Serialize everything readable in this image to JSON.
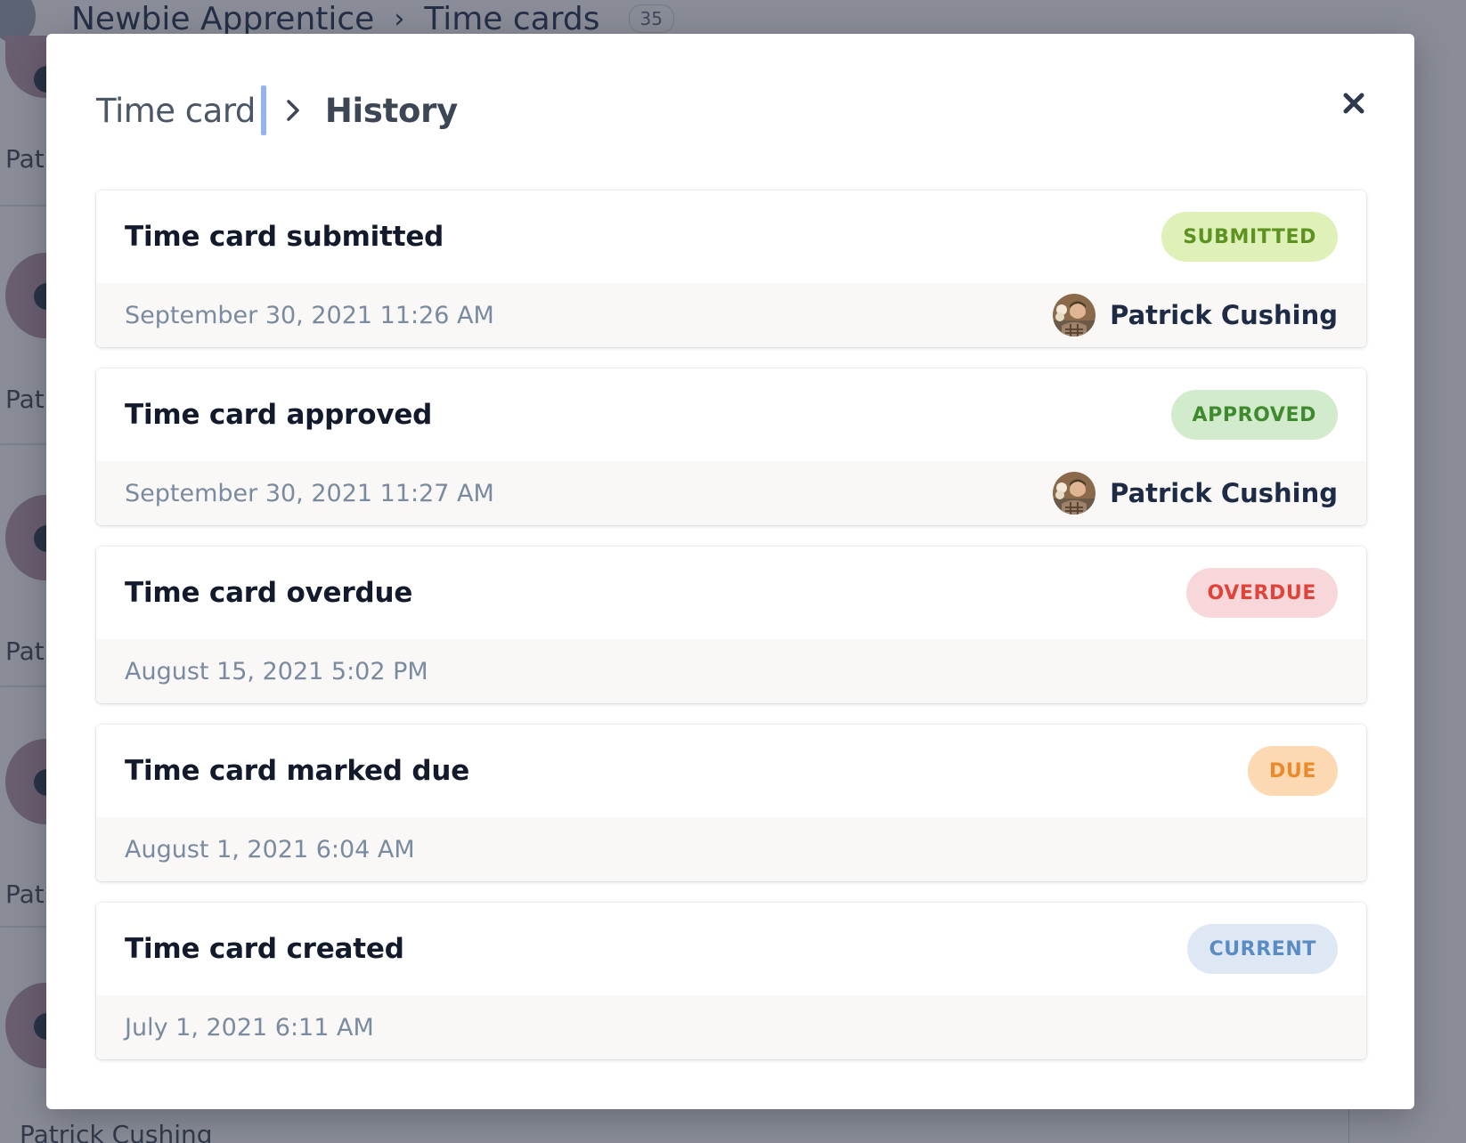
{
  "background": {
    "breadcrumb_parent": "Newbie Apprentice",
    "breadcrumb_current": "Time cards",
    "count": "35",
    "row_names": [
      "Pat",
      "Pat",
      "Pat",
      "Pat",
      "Patrick Cushing"
    ]
  },
  "modal": {
    "breadcrumb_root": "Time card",
    "breadcrumb_current": "History",
    "close_icon": "close-icon"
  },
  "events": [
    {
      "title": "Time card submitted",
      "status": "SUBMITTED",
      "status_bg": "#dff0b9",
      "status_color": "#5c9220",
      "date": "September 30, 2021 11:26 AM",
      "user": "Patrick Cushing"
    },
    {
      "title": "Time card approved",
      "status": "APPROVED",
      "status_bg": "#d2ebcc",
      "status_color": "#3f8a2e",
      "date": "September 30, 2021 11:27 AM",
      "user": "Patrick Cushing"
    },
    {
      "title": "Time card overdue",
      "status": "OVERDUE",
      "status_bg": "#f8d7db",
      "status_color": "#e0433a",
      "date": "August 15, 2021 5:02 PM",
      "user": ""
    },
    {
      "title": "Time card marked due",
      "status": "DUE",
      "status_bg": "#fcd9b2",
      "status_color": "#ea8a2a",
      "date": "August 1, 2021 6:04 AM",
      "user": ""
    },
    {
      "title": "Time card created",
      "status": "CURRENT",
      "status_bg": "#dde8f4",
      "status_color": "#5a8bc2",
      "date": "July 1, 2021 6:11 AM",
      "user": ""
    }
  ]
}
